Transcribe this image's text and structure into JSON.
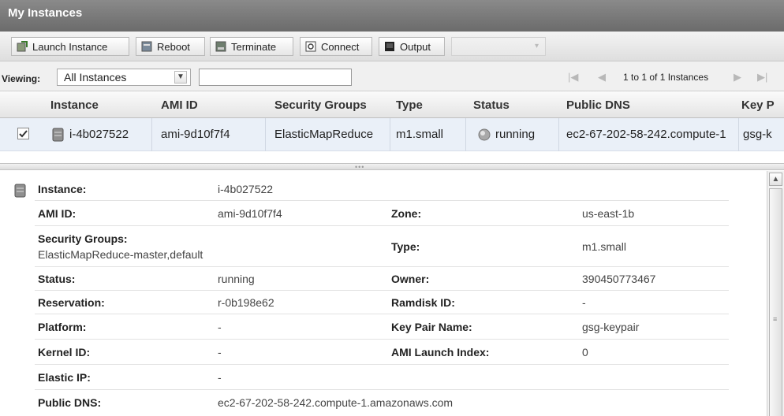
{
  "window": {
    "title": "My Instances"
  },
  "toolbar": {
    "launch_label": "Launch Instance",
    "reboot_label": "Reboot",
    "terminate_label": "Terminate",
    "connect_label": "Connect",
    "output_label": "Output"
  },
  "viewing": {
    "label": "Viewing:",
    "selected": "All Instances",
    "search_value": ""
  },
  "pager": {
    "text": "1 to 1 of 1 Instances"
  },
  "grid": {
    "columns": [
      "Instance",
      "AMI ID",
      "Security Groups",
      "Type",
      "Status",
      "Public DNS",
      "Key P"
    ],
    "rows": [
      {
        "checked": true,
        "instance": "i-4b027522",
        "ami": "ami-9d10f7f4",
        "security_groups": "ElasticMapReduce",
        "type": "m1.small",
        "status": "running",
        "public_dns": "ec2-67-202-58-242.compute-1",
        "key": "gsg-k"
      }
    ]
  },
  "detail": {
    "instance_label": "Instance:",
    "instance_value": "i-4b027522",
    "ami_label": "AMI ID:",
    "ami_value": "ami-9d10f7f4",
    "zone_label": "Zone:",
    "zone_value": "us-east-1b",
    "sg_label": "Security Groups:",
    "sg_value": "ElasticMapReduce-master,default",
    "type_label": "Type:",
    "type_value": "m1.small",
    "status_label": "Status:",
    "status_value": "running",
    "owner_label": "Owner:",
    "owner_value": "390450773467",
    "reservation_label": "Reservation:",
    "reservation_value": "r-0b198e62",
    "ramdisk_label": "Ramdisk ID:",
    "ramdisk_value": "-",
    "platform_label": "Platform:",
    "platform_value": "-",
    "keypair_label": "Key Pair Name:",
    "keypair_value": "gsg-keypair",
    "kernel_label": "Kernel ID:",
    "kernel_value": "-",
    "launch_index_label": "AMI Launch Index:",
    "launch_index_value": "0",
    "elastic_label": "Elastic IP:",
    "elastic_value": "-",
    "dns_label": "Public DNS:",
    "dns_value": "ec2-67-202-58-242.compute-1.amazonaws.com"
  },
  "icons": {
    "launch": "launch-icon",
    "reboot": "reboot-icon",
    "terminate": "terminate-icon",
    "connect": "connect-icon",
    "output": "output-icon",
    "server": "server-icon",
    "status": "status-dot-icon"
  }
}
